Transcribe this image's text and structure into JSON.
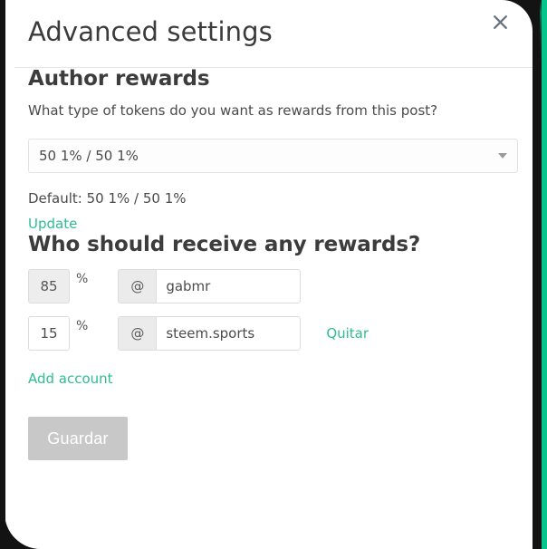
{
  "dialog": {
    "title": "Advanced settings",
    "close_icon": "close-icon"
  },
  "author_rewards": {
    "heading": "Author rewards",
    "description": "What type of tokens do you want as rewards from this post?",
    "select": {
      "selected": "50 1% / 50 1%",
      "caret_icon": "chevron-down-icon"
    },
    "default_text": "Default: 50 1% / 50 1%",
    "update_link": "Update"
  },
  "beneficiaries": {
    "heading": "Who should receive any rewards?",
    "at_symbol": "@",
    "percent_symbol": "%",
    "rows": [
      {
        "percent": "85",
        "account": "gabmr",
        "remove_label": "",
        "percent_disabled": true
      },
      {
        "percent": "15",
        "account": "steem.sports",
        "remove_label": "Quitar",
        "percent_disabled": false
      }
    ],
    "add_account_label": "Add account"
  },
  "footer": {
    "save_label": "Guardar"
  },
  "colors": {
    "accent_teal": "#2ebd91",
    "edge_accent": "#06c58c",
    "backdrop": "#131313",
    "disabled_button": "#c8c8c8"
  }
}
